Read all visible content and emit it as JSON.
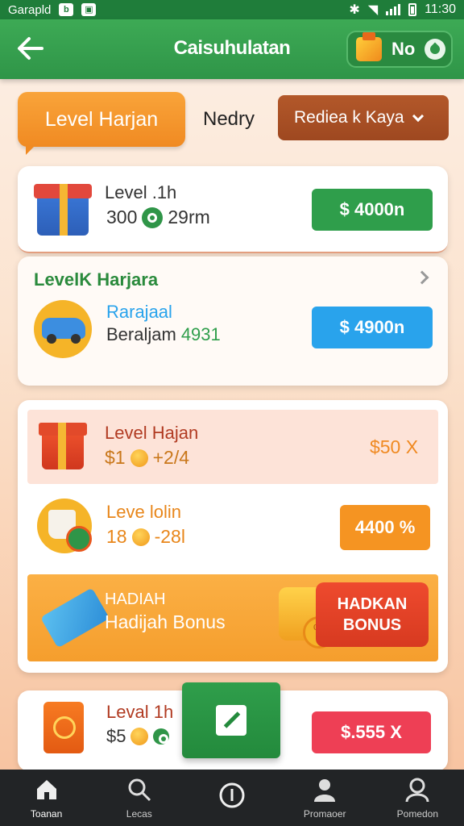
{
  "status_bar": {
    "carrier": "Garapld",
    "time": "11:30"
  },
  "header": {
    "title": "Caisuhulatan",
    "pill_label": "No"
  },
  "filters": {
    "level_tab": "Level Harjan",
    "middle_label": "Nedry",
    "dropdown_value": "Rediea k Kaya"
  },
  "items": [
    {
      "title": "Level .1h",
      "sub_a": "300",
      "sub_b": "29rm",
      "price": "$ 4000n",
      "price_color": "#2f9e4b"
    },
    {
      "section": "LevelK Harjara",
      "title": "Rarajaal",
      "sub_a": "Beraljam",
      "sub_b": "4931",
      "price": "$ 4900n",
      "price_color": "#29a3ec"
    },
    {
      "title": "Level Hajan",
      "sub_a": "$1",
      "sub_b": "+2/4",
      "price": "$50 X",
      "price_color": "#f08a22"
    },
    {
      "title": "Leve lolin",
      "sub_a": "18",
      "sub_b": "-28l",
      "price": "4400 %",
      "price_color": "#f59422"
    },
    {
      "title": "Leval  1h",
      "sub_a": "$5",
      "price": "$.555 X",
      "price_color": "#ee3f55"
    }
  ],
  "bonus": {
    "line1": "HADIAH",
    "line2": "Hadijah Bonus",
    "badge_line1": "HADKAN",
    "badge_line2": "BONUS"
  },
  "bottom_nav": [
    {
      "label": "Toanan",
      "icon": "home-icon"
    },
    {
      "label": "Lecas",
      "icon": "search-icon"
    },
    {
      "label": "",
      "icon": "info-icon"
    },
    {
      "label": "Promaoer",
      "icon": "profile-icon"
    },
    {
      "label": "Pomedon",
      "icon": "user-icon"
    }
  ],
  "colors": {
    "primary_green": "#2f9548",
    "accent_orange": "#f08a22",
    "brown": "#9e4820"
  }
}
